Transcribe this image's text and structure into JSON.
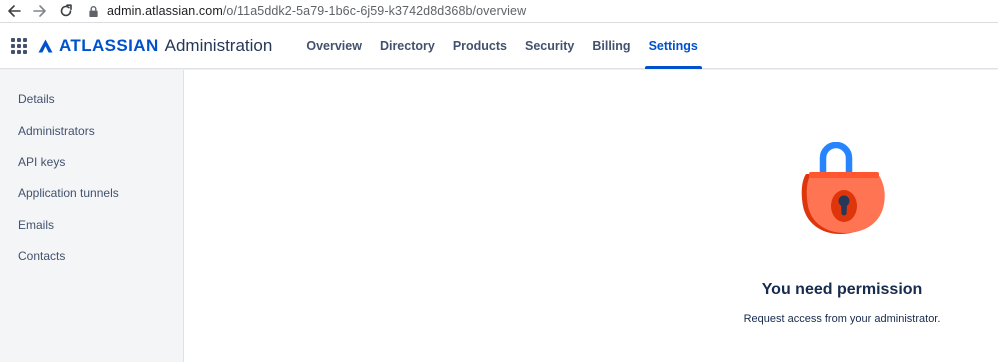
{
  "browser": {
    "url_host": "admin.atlassian.com",
    "url_path": "/o/11a5ddk2-5a79-1b6c-6j59-k3742d8d368b/overview",
    "icons": [
      "back-arrow-icon",
      "forward-arrow-icon",
      "reload-icon",
      "lock-icon"
    ]
  },
  "header": {
    "brand_name": "ATLASSIAN",
    "brand_sub": "Administration",
    "brand_color": "#0052cc",
    "tabs": [
      {
        "label": "Overview",
        "active": false
      },
      {
        "label": "Directory",
        "active": false
      },
      {
        "label": "Products",
        "active": false
      },
      {
        "label": "Security",
        "active": false
      },
      {
        "label": "Billing",
        "active": false
      },
      {
        "label": "Settings",
        "active": true
      }
    ]
  },
  "sidebar": {
    "items": [
      {
        "label": "Details"
      },
      {
        "label": "Administrators"
      },
      {
        "label": "API keys"
      },
      {
        "label": "Application tunnels"
      },
      {
        "label": "Emails"
      },
      {
        "label": "Contacts"
      }
    ]
  },
  "main": {
    "title": "You need permission",
    "description": "Request access from your administrator.",
    "illustration": "padlock-icon",
    "lock_body_color": "#ff7452",
    "lock_shackle_color": "#2684ff"
  }
}
